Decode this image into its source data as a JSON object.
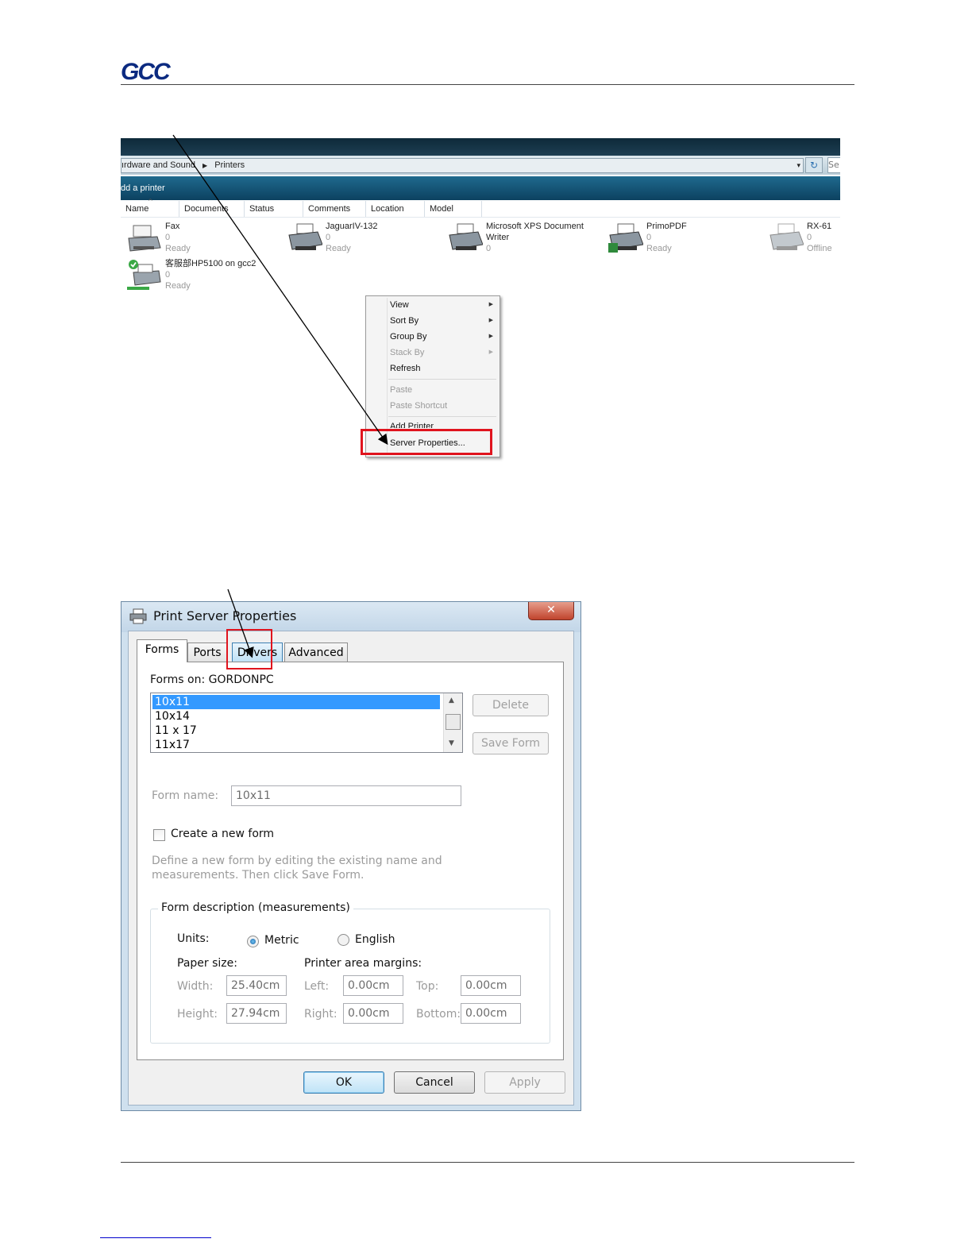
{
  "header": {
    "logo_text": "GCC",
    "logo_sub": ""
  },
  "explorer": {
    "breadcrumb": [
      "ırdware and Sound",
      "Printers"
    ],
    "search_label": "Se",
    "add_printer_label": "dd a printer",
    "columns": [
      "Name",
      "Documents",
      "Status",
      "Comments",
      "Location",
      "Model"
    ],
    "printers": [
      {
        "name": "Fax",
        "docs": "0",
        "status": "Ready"
      },
      {
        "name": "JaguarIV-132",
        "docs": "0",
        "status": "Ready"
      },
      {
        "name": "Microsoft XPS Document",
        "name2": "Writer",
        "docs": "0",
        "status": ""
      },
      {
        "name": "PrimoPDF",
        "docs": "0",
        "status": "Ready"
      },
      {
        "name": "RX-61",
        "docs": "0",
        "status": "Offline"
      },
      {
        "name": "客服部HP5100 on gcc2",
        "docs": "0",
        "status": "Ready"
      }
    ],
    "context_menu": {
      "view": "View",
      "sort_by": "Sort By",
      "group_by": "Group By",
      "stack_by": "Stack By",
      "refresh": "Refresh",
      "paste": "Paste",
      "paste_shortcut": "Paste Shortcut",
      "add_printer": "Add Printer",
      "server_properties": "Server Properties..."
    }
  },
  "dialog": {
    "title": "Print Server Properties",
    "close_glyph": "✕",
    "tabs": [
      "Forms",
      "Ports",
      "Drivers",
      "Advanced"
    ],
    "forms_on_label": "Forms on:",
    "forms_on_value": "GORDONPC",
    "forms_list": [
      "10x11",
      "10x14",
      "11 x 17",
      "11x17"
    ],
    "delete_label": "Delete",
    "save_form_label": "Save Form",
    "form_name_label": "Form name:",
    "form_name_value": "10x11",
    "create_new_form_label": "Create a new form",
    "hint_line1": "Define a new form by editing the existing name and",
    "hint_line2": "measurements.  Then click Save Form.",
    "group_caption": "Form description (measurements)",
    "units_label": "Units:",
    "metric_label": "Metric",
    "english_label": "English",
    "paper_size_label": "Paper size:",
    "margins_label": "Printer area margins:",
    "width_label": "Width:",
    "width_value": "25.40cm",
    "height_label": "Height:",
    "height_value": "27.94cm",
    "left_label": "Left:",
    "left_value": "0.00cm",
    "right_label": "Right:",
    "right_value": "0.00cm",
    "top_label": "Top:",
    "top_value": "0.00cm",
    "bottom_label": "Bottom:",
    "bottom_value": "0.00cm",
    "ok_label": "OK",
    "cancel_label": "Cancel",
    "apply_label": "Apply"
  },
  "colors": {
    "highlight_box": "#e0141e",
    "selection": "#3399ff",
    "logo": "#0b2a80"
  }
}
